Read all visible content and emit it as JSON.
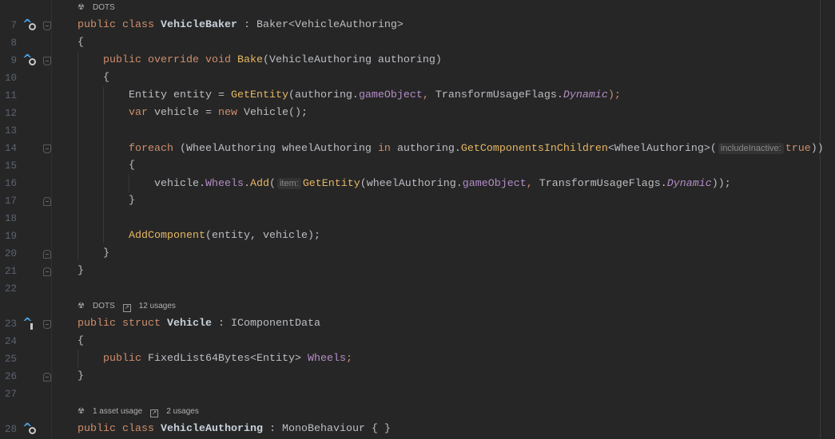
{
  "editor": {
    "rows": [
      {
        "hints": [
          {
            "icon": "unity-icon",
            "text": "DOTS"
          }
        ]
      },
      {
        "line": "7",
        "gutter": "override-circle",
        "fold": "start",
        "tokens": [
          [
            "public class ",
            "kw"
          ],
          [
            "VehicleBaker",
            "decl"
          ],
          [
            " : Baker<VehicleAuthoring>",
            "ph"
          ]
        ]
      },
      {
        "line": "8",
        "tokens": [
          [
            "{",
            "ph"
          ]
        ]
      },
      {
        "line": "9",
        "gutter": "override-circle",
        "fold": "start",
        "tokens": [
          [
            "    public override void ",
            "kw"
          ],
          [
            "Bake",
            "fn"
          ],
          [
            "(VehicleAuthoring authoring)",
            "ph"
          ]
        ]
      },
      {
        "line": "10",
        "tokens": [
          [
            "    {",
            "ph"
          ]
        ]
      },
      {
        "line": "11",
        "tokens": [
          [
            "        Entity entity = ",
            "ph"
          ],
          [
            "GetEntity",
            "fn"
          ],
          [
            "(authoring.",
            "ph"
          ],
          [
            "gameObject",
            "fld"
          ],
          [
            ", ",
            "kw"
          ],
          [
            "TransformUsageFlags.",
            "ph"
          ],
          [
            "Dynamic",
            "en"
          ],
          [
            ");",
            "kw"
          ]
        ]
      },
      {
        "line": "12",
        "tokens": [
          [
            "        var ",
            "kw"
          ],
          [
            "vehicle = ",
            "ph"
          ],
          [
            "new ",
            "kw"
          ],
          [
            "Vehicle();",
            "ph"
          ]
        ]
      },
      {
        "line": "13",
        "tokens": []
      },
      {
        "line": "14",
        "fold": "start",
        "tokens": [
          [
            "        foreach ",
            "kw"
          ],
          [
            "(WheelAuthoring wheelAuthoring ",
            "ph"
          ],
          [
            "in ",
            "kw"
          ],
          [
            "authoring.",
            "ph"
          ],
          [
            "GetComponentsInChildren",
            "fn"
          ],
          [
            "<WheelAuthoring>(",
            "ph"
          ],
          [
            "includeInactive:",
            "hint"
          ],
          [
            "true",
            "kw"
          ],
          [
            "))",
            "ph"
          ]
        ]
      },
      {
        "line": "15",
        "tokens": [
          [
            "        {",
            "ph"
          ]
        ]
      },
      {
        "line": "16",
        "tokens": [
          [
            "            vehicle.",
            "ph"
          ],
          [
            "Wheels",
            "fld"
          ],
          [
            ".",
            "ph"
          ],
          [
            "Add",
            "fn"
          ],
          [
            "(",
            "ph"
          ],
          [
            "item:",
            "hint"
          ],
          [
            "GetEntity",
            "fn"
          ],
          [
            "(wheelAuthoring.",
            "ph"
          ],
          [
            "gameObject",
            "fld"
          ],
          [
            ", ",
            "kw"
          ],
          [
            "TransformUsageFlags.",
            "ph"
          ],
          [
            "Dynamic",
            "en"
          ],
          [
            "));",
            "ph"
          ]
        ]
      },
      {
        "line": "17",
        "fold": "end",
        "tokens": [
          [
            "        }",
            "ph"
          ]
        ]
      },
      {
        "line": "18",
        "tokens": []
      },
      {
        "line": "19",
        "tokens": [
          [
            "        ",
            "ph"
          ],
          [
            "AddComponent",
            "fn"
          ],
          [
            "(entity, ",
            "ph"
          ],
          [
            "vehicle);",
            "ph"
          ]
        ]
      },
      {
        "line": "20",
        "fold": "end",
        "tokens": [
          [
            "    }",
            "ph"
          ]
        ]
      },
      {
        "line": "21",
        "fold": "end",
        "tokens": [
          [
            "}",
            "ph"
          ]
        ]
      },
      {
        "line": "22",
        "tokens": []
      },
      {
        "hints": [
          {
            "icon": "unity-icon",
            "text": "DOTS"
          },
          {
            "icon": "usages-icon",
            "text": "12 usages"
          }
        ]
      },
      {
        "line": "23",
        "gutter": "implemented-bar",
        "fold": "start",
        "tokens": [
          [
            "public struct ",
            "kw"
          ],
          [
            "Vehicle",
            "decl"
          ],
          [
            " : IComponentData",
            "ph"
          ]
        ]
      },
      {
        "line": "24",
        "tokens": [
          [
            "{",
            "ph"
          ]
        ]
      },
      {
        "line": "25",
        "tokens": [
          [
            "    public ",
            "kw"
          ],
          [
            "FixedList64Bytes<Entity> ",
            "ph"
          ],
          [
            "Wheels",
            "fld"
          ],
          [
            ";",
            "kw"
          ]
        ]
      },
      {
        "line": "26",
        "fold": "end",
        "tokens": [
          [
            "}",
            "ph"
          ]
        ]
      },
      {
        "line": "27",
        "tokens": []
      },
      {
        "hints": [
          {
            "icon": "unity-icon",
            "text": "1 asset usage"
          },
          {
            "icon": "usages-icon",
            "text": "2 usages"
          }
        ]
      },
      {
        "line": "28",
        "gutter": "override-circle",
        "tokens": [
          [
            "public class ",
            "kw"
          ],
          [
            "VehicleAuthoring",
            "decl"
          ],
          [
            " : MonoBehaviour { }",
            "ph"
          ]
        ]
      }
    ]
  }
}
